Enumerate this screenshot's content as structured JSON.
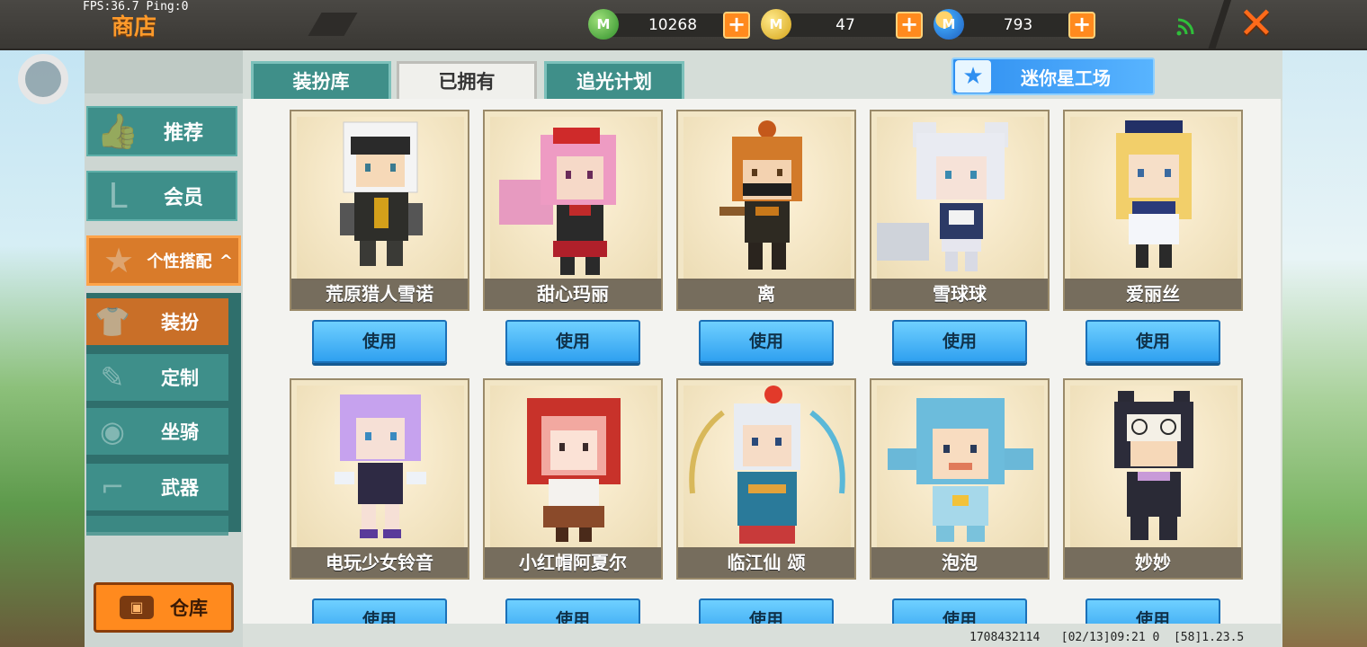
{
  "hud": {
    "fps_text": "FPS:36.7  Ping:0",
    "shop_title": "商店",
    "currencies": [
      {
        "name": "mini-bean",
        "icon": "green-bean-icon",
        "value": "10268",
        "add": "+",
        "color": "#3aa43a"
      },
      {
        "name": "mini-coin",
        "icon": "gold-coin-icon",
        "value": "47",
        "add": "+",
        "color": "#e0b21e"
      },
      {
        "name": "star-coin",
        "icon": "blue-coin-icon",
        "value": "793",
        "add": "+",
        "color": "#2f7fe0"
      }
    ],
    "close": "✕"
  },
  "sidebar": {
    "items": [
      {
        "label": "推荐",
        "icon": "thumbs-up-icon"
      },
      {
        "label": "会员",
        "icon": "vip-badge-icon"
      },
      {
        "label": "个性搭配",
        "icon": "trophy-icon",
        "expanded": true
      }
    ],
    "sub_items": [
      {
        "label": "装扮",
        "icon": "shirt-icon",
        "active": true
      },
      {
        "label": "定制",
        "icon": "brush-icon"
      },
      {
        "label": "坐骑",
        "icon": "mount-icon"
      },
      {
        "label": "武器",
        "icon": "revolver-icon"
      }
    ],
    "warehouse": "仓库"
  },
  "tabs": [
    {
      "label": "装扮库",
      "active": false
    },
    {
      "label": "已拥有",
      "active": true
    },
    {
      "label": "追光计划",
      "active": false
    }
  ],
  "studio_button": "迷你星工场",
  "use_label": "使用",
  "skins": [
    {
      "name": "荒原猎人雪诺"
    },
    {
      "name": "甜心玛丽"
    },
    {
      "name": "离"
    },
    {
      "name": "雪球球"
    },
    {
      "name": "爱丽丝"
    },
    {
      "name": "电玩少女铃音"
    },
    {
      "name": "小红帽阿夏尔"
    },
    {
      "name": "临江仙 颂"
    },
    {
      "name": "泡泡"
    },
    {
      "name": "妙妙"
    }
  ],
  "footer": "1708432114   [02/13]09:21 0  [58]1.23.5",
  "colors": {
    "accent": "#ff8a1e",
    "teal": "#3e8f8a",
    "use_button": "#2fa0f0"
  }
}
